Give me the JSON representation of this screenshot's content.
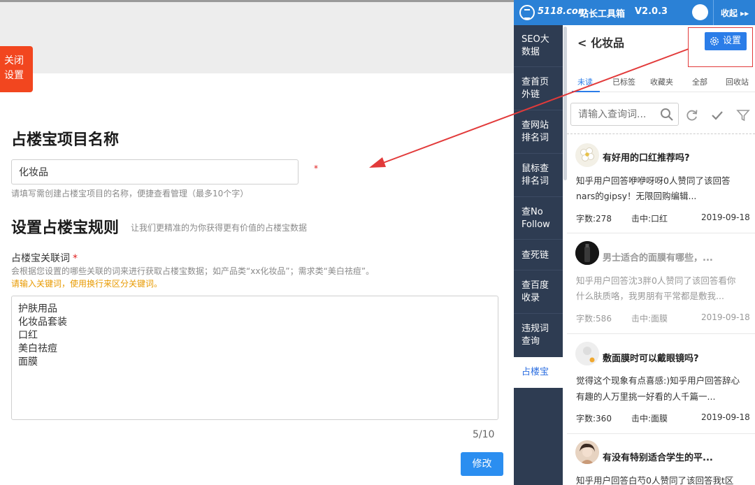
{
  "left": {
    "close_label_1": "关闭",
    "close_label_2": "设置",
    "title": "占楼宝项目名称",
    "name_value": "化妆品",
    "required_mark": "*",
    "name_hint": "请填写需创建占楼宝项目的名称，便捷查看管理（最多10个字）",
    "rules_title": "设置占楼宝规则",
    "rules_subtitle": "让我们更精准的为你获得更有价值的占楼宝数据",
    "kw_label": "占楼宝关联词",
    "kw_hint": "会根据您设置的哪些关联的词来进行获取占楼宝数据；如产品类“xx化妆品”；需求类“美白祛痘”。",
    "kw_warn": "请输入关键词，使用换行来区分关键词。",
    "keywords": [
      "护肤用品",
      "化妆品套装",
      "口红",
      "美白祛痘",
      "面膜"
    ],
    "count": "5/10",
    "modify_label": "修改"
  },
  "plugin": {
    "logo": "5118.com",
    "tool_name": "站长工具箱",
    "version": "V2.0.3",
    "collapse": "收起 ▸▸",
    "sidebar": [
      {
        "l1": "SEO大",
        "l2": "数据"
      },
      {
        "l1": "查首页",
        "l2": "外链"
      },
      {
        "l1": "查网站",
        "l2": "排名词"
      },
      {
        "l1": "鼠标查",
        "l2": "排名词"
      },
      {
        "l1": "查No",
        "l2": "Follow"
      },
      {
        "l1": "查死链",
        "l2": ""
      },
      {
        "l1": "查百度",
        "l2": "收录"
      },
      {
        "l1": "违规词",
        "l2": "查询"
      },
      {
        "l1": "占楼宝",
        "l2": ""
      }
    ],
    "panel_title": "< 化妆品",
    "settings_label": "设置",
    "tabs": [
      "未读",
      "已标签",
      "收藏夹",
      "全部",
      "回收站"
    ],
    "search_placeholder": "请输入查询词...",
    "cards": [
      {
        "title": "有好用的口红推荐吗?",
        "line1": "知乎用户回答咿咿呀呀0人赞同了该回答",
        "line2": "nars的gipsy！无限回购编辑...",
        "words": "字数:278",
        "hit": "击中:口红",
        "date": "2019-09-18",
        "muted": false
      },
      {
        "title": "男士适合的面膜有哪些，...",
        "line1": "知乎用户回答沈3胖0人赞同了该回答看你",
        "line2": "什么肤质咯，我男朋有平常都是敷我...",
        "words": "字数:586",
        "hit": "击中:面膜",
        "date": "2019-09-18",
        "muted": true
      },
      {
        "title": "敷面膜时可以戴眼镜吗?",
        "line1": "觉得这个现象有点喜感:)知乎用户回答辞心",
        "line2": "有趣的人万里挑一好看的人千篇一...",
        "words": "字数:360",
        "hit": "击中:面膜",
        "date": "2019-09-18",
        "muted": false
      },
      {
        "title": "有没有特别适合学生的平...",
        "line1": "知乎用户回答白芍0人赞同了该回答我t区",
        "line2": "",
        "words": "",
        "hit": "",
        "date": "",
        "muted": false
      }
    ]
  },
  "colors": {
    "accent": "#2b7de8",
    "header": "#2b81d6",
    "sidebar": "#2e3c52",
    "close": "#f2461f",
    "warn": "#e89a00",
    "annotation": "#e23a3a"
  }
}
